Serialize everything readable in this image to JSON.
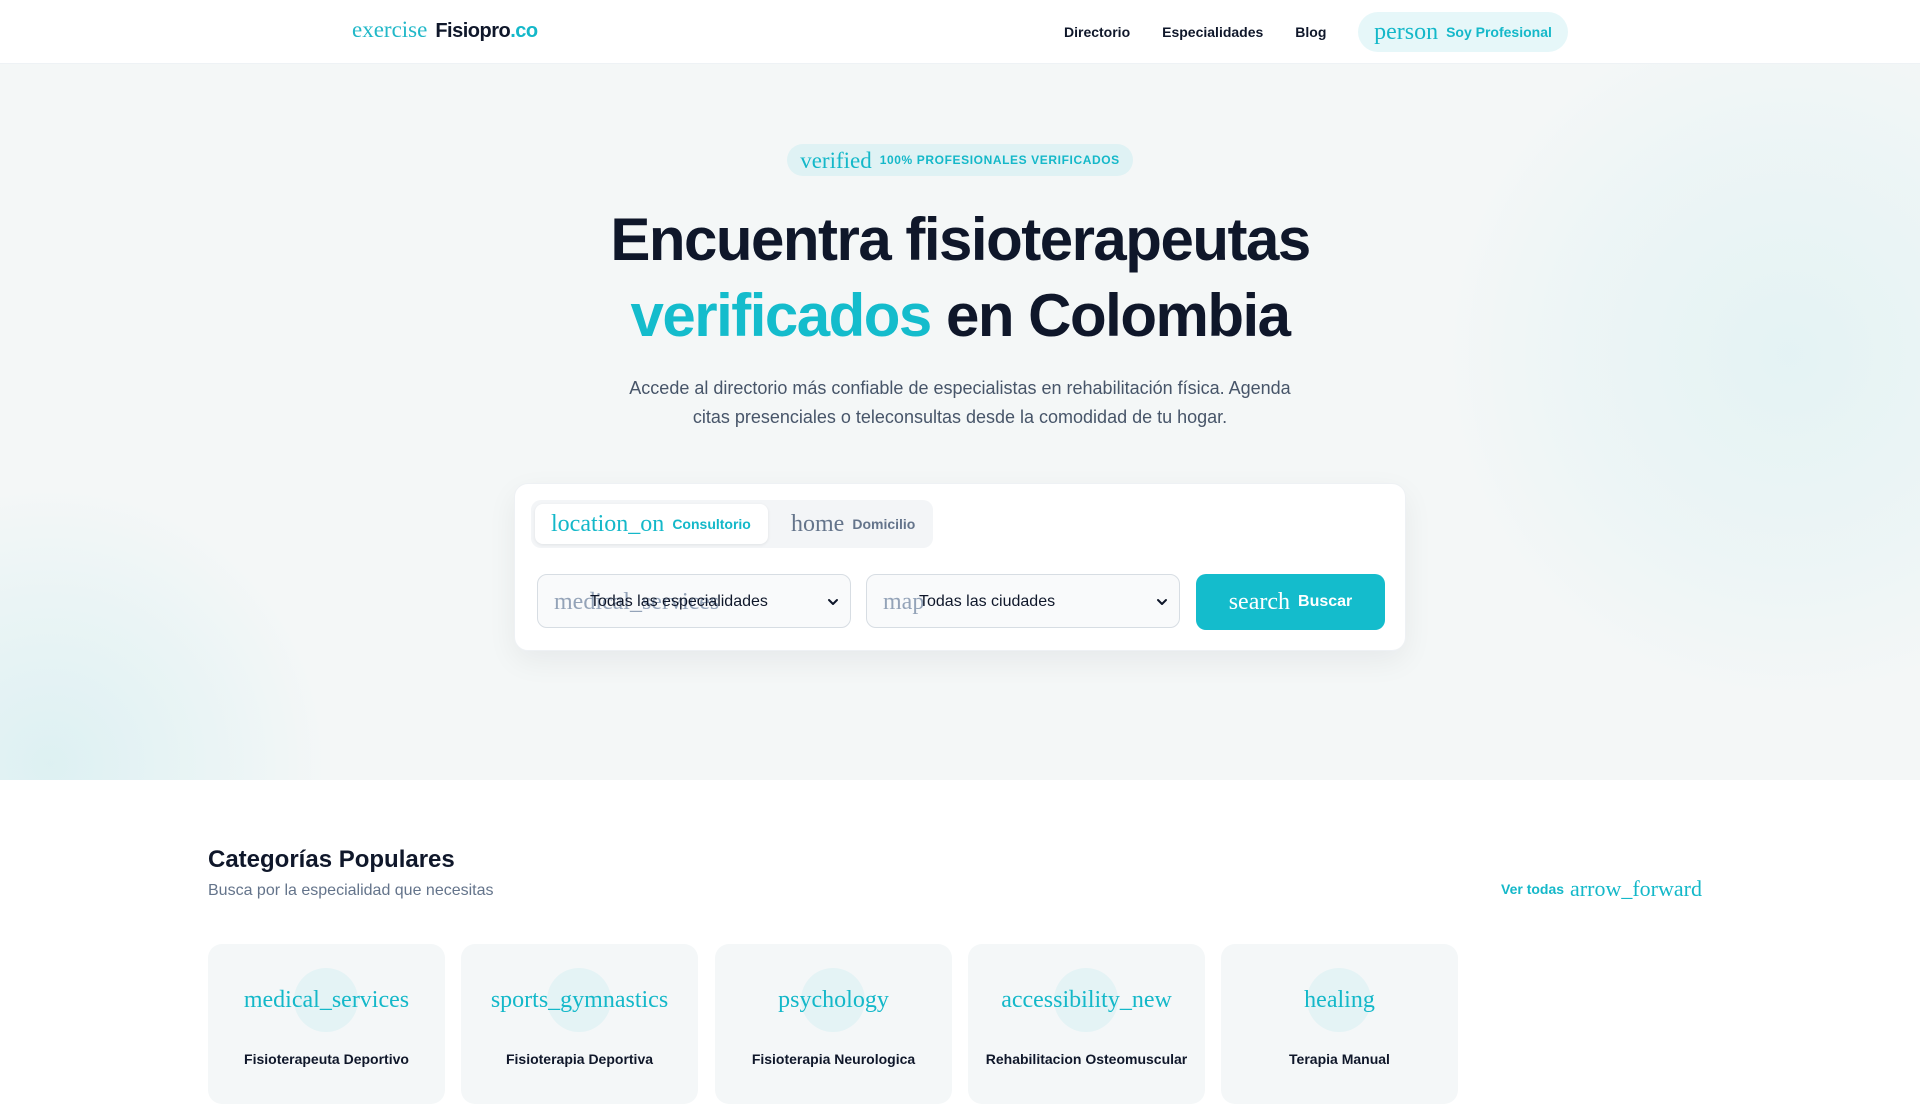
{
  "nav": {
    "logo_icon": "exercise",
    "brand_name": "Fisiopro",
    "brand_tld": ".co",
    "links": [
      "Directorio",
      "Especialidades",
      "Blog"
    ],
    "pro_button": {
      "icon": "person",
      "label": "Soy Profesional"
    }
  },
  "hero": {
    "badge": {
      "icon": "verified",
      "label": "100% PROFESIONALES VERIFICADOS"
    },
    "title_line1": "Encuentra fisioterapeutas",
    "title_accent": "verificados",
    "title_rest": " en Colombia",
    "subtitle": "Accede al directorio más confiable de especialistas en rehabilitación física. Agenda citas presenciales o teleconsultas desde la comodidad de tu hogar."
  },
  "search": {
    "tabs": [
      {
        "icon": "location_on",
        "label": "Consultorio",
        "active": true
      },
      {
        "icon": "home",
        "label": "Domicilio",
        "active": false
      }
    ],
    "specialty": {
      "icon": "medical_services",
      "value": "Todas las especialidades"
    },
    "city": {
      "icon": "map",
      "value": "Todas las ciudades"
    },
    "button": {
      "icon": "search",
      "label": "Buscar"
    }
  },
  "categories": {
    "title": "Categorías Populares",
    "subtitle": "Busca por la especialidad que necesitas",
    "see_all": {
      "label": "Ver todas",
      "icon": "arrow_forward"
    },
    "items": [
      {
        "icon": "medical_services",
        "name": "Fisioterapeuta Deportivo"
      },
      {
        "icon": "sports_gymnastics",
        "name": "Fisioterapia Deportiva"
      },
      {
        "icon": "psychology",
        "name": "Fisioterapia Neurologica"
      },
      {
        "icon": "accessibility_new",
        "name": "Rehabilitacion Osteomuscular"
      },
      {
        "icon": "healing",
        "name": "Terapia Manual"
      }
    ]
  },
  "colors": {
    "accent": "#14bccc",
    "text": "#0f172a",
    "muted": "#64748b",
    "hero_bg": "#f4f7f7"
  }
}
